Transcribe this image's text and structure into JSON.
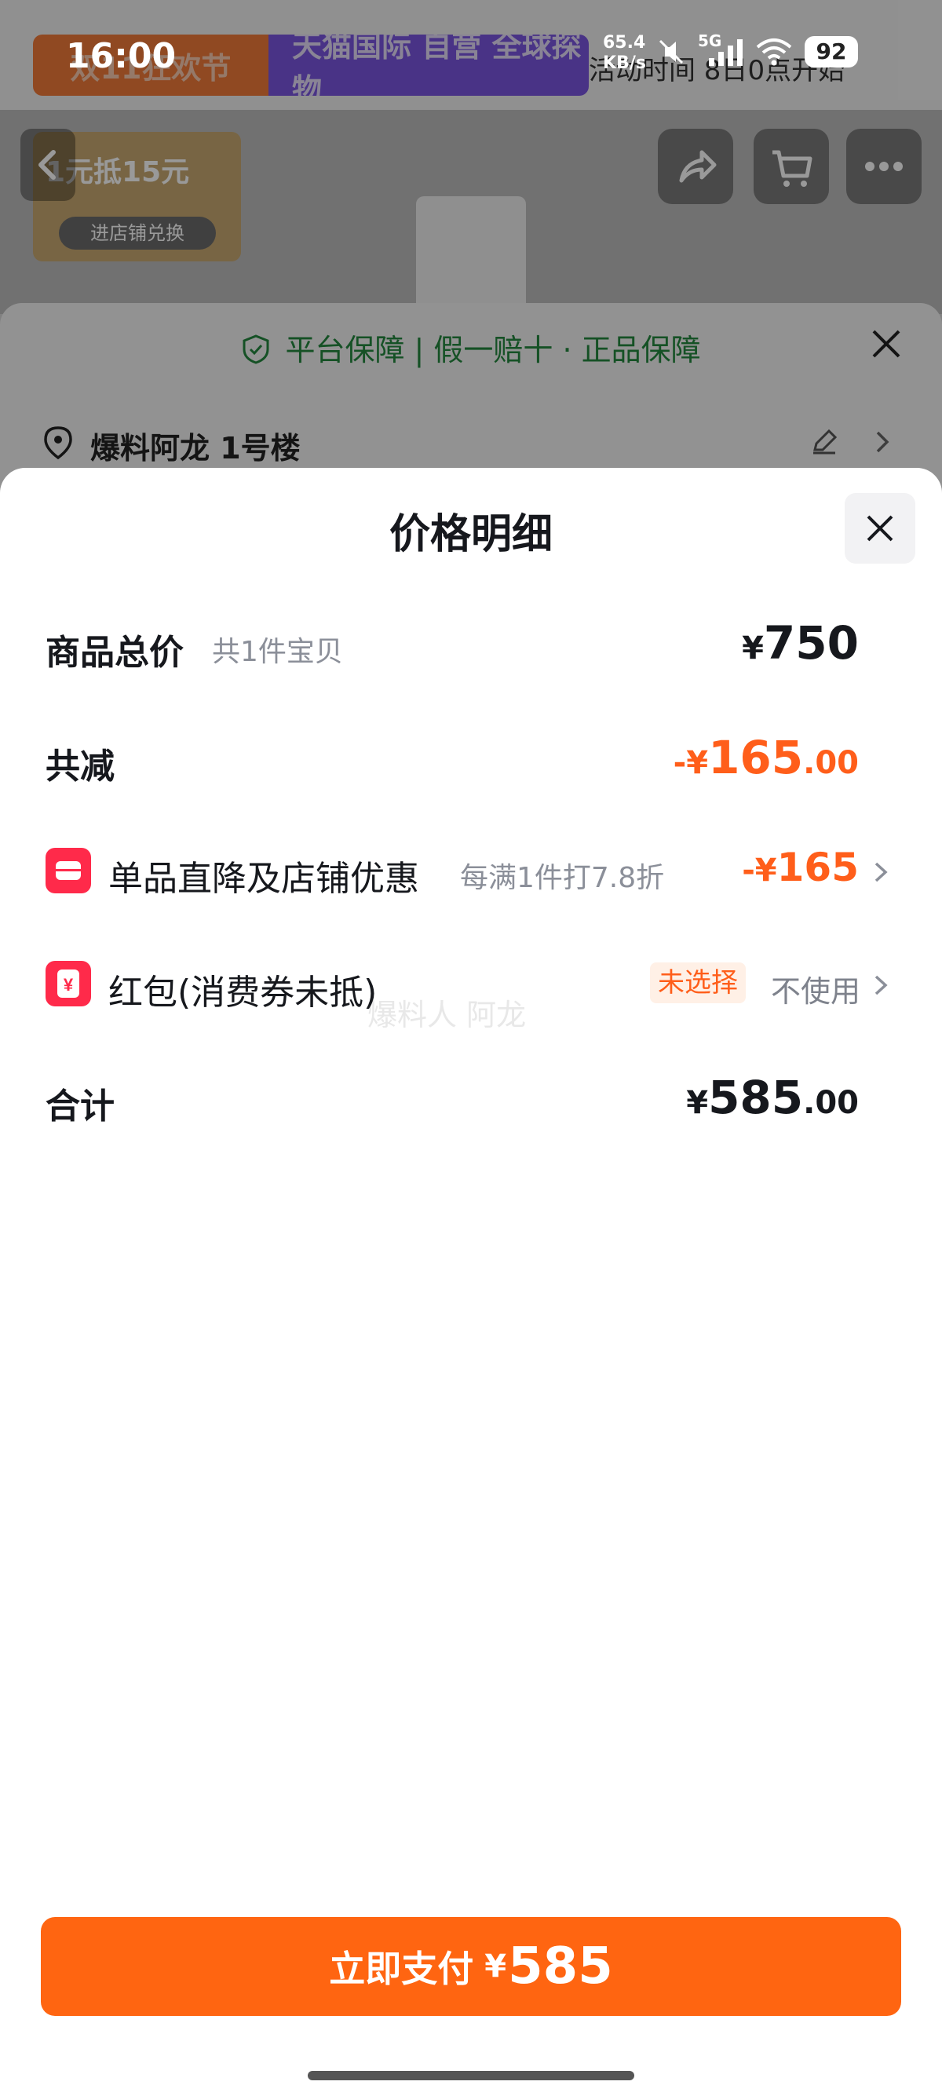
{
  "status_bar": {
    "time": "16:00",
    "net_speed_value": "65.4",
    "net_speed_unit": "KB/s",
    "network": "5G",
    "battery": "92"
  },
  "background_page": {
    "promo_left": "双11狂欢节",
    "promo_right": "天猫国际 自营 全球探物",
    "promo_time": "活动时间 8日0点开始",
    "coupon_text": "1元抵15元",
    "coupon_button": "进店铺兑换",
    "guarantee": "平台保障 | 假一赔十 · 正品保障",
    "address": "爆料阿龙 1号楼"
  },
  "price_detail": {
    "title": "价格明细",
    "total_label": "商品总价",
    "total_sub": "共1件宝贝",
    "total_currency": "¥",
    "total_value": "750",
    "reduce_label": "共减",
    "reduce_prefix": "-¥",
    "reduce_value": "165",
    "reduce_decimal": ".00",
    "discount_label": "单品直降及店铺优惠",
    "discount_sub": "每满1件打7.8折",
    "discount_prefix": "-¥",
    "discount_value": "165",
    "redpacket_label": "红包(消费券未抵)",
    "redpacket_tag": "未选择",
    "redpacket_action": "不使用",
    "watermark": "爆料人 阿龙",
    "sum_label": "合计",
    "sum_currency": "¥",
    "sum_value": "585",
    "sum_decimal": ".00"
  },
  "pay_button": {
    "label": "立即支付",
    "currency": "¥",
    "amount": "585"
  },
  "colors": {
    "accent_orange": "#ff5e1a",
    "pay_button": "#ff6511",
    "icon_red": "#ff2a4a",
    "guarantee_green": "#23883f"
  }
}
